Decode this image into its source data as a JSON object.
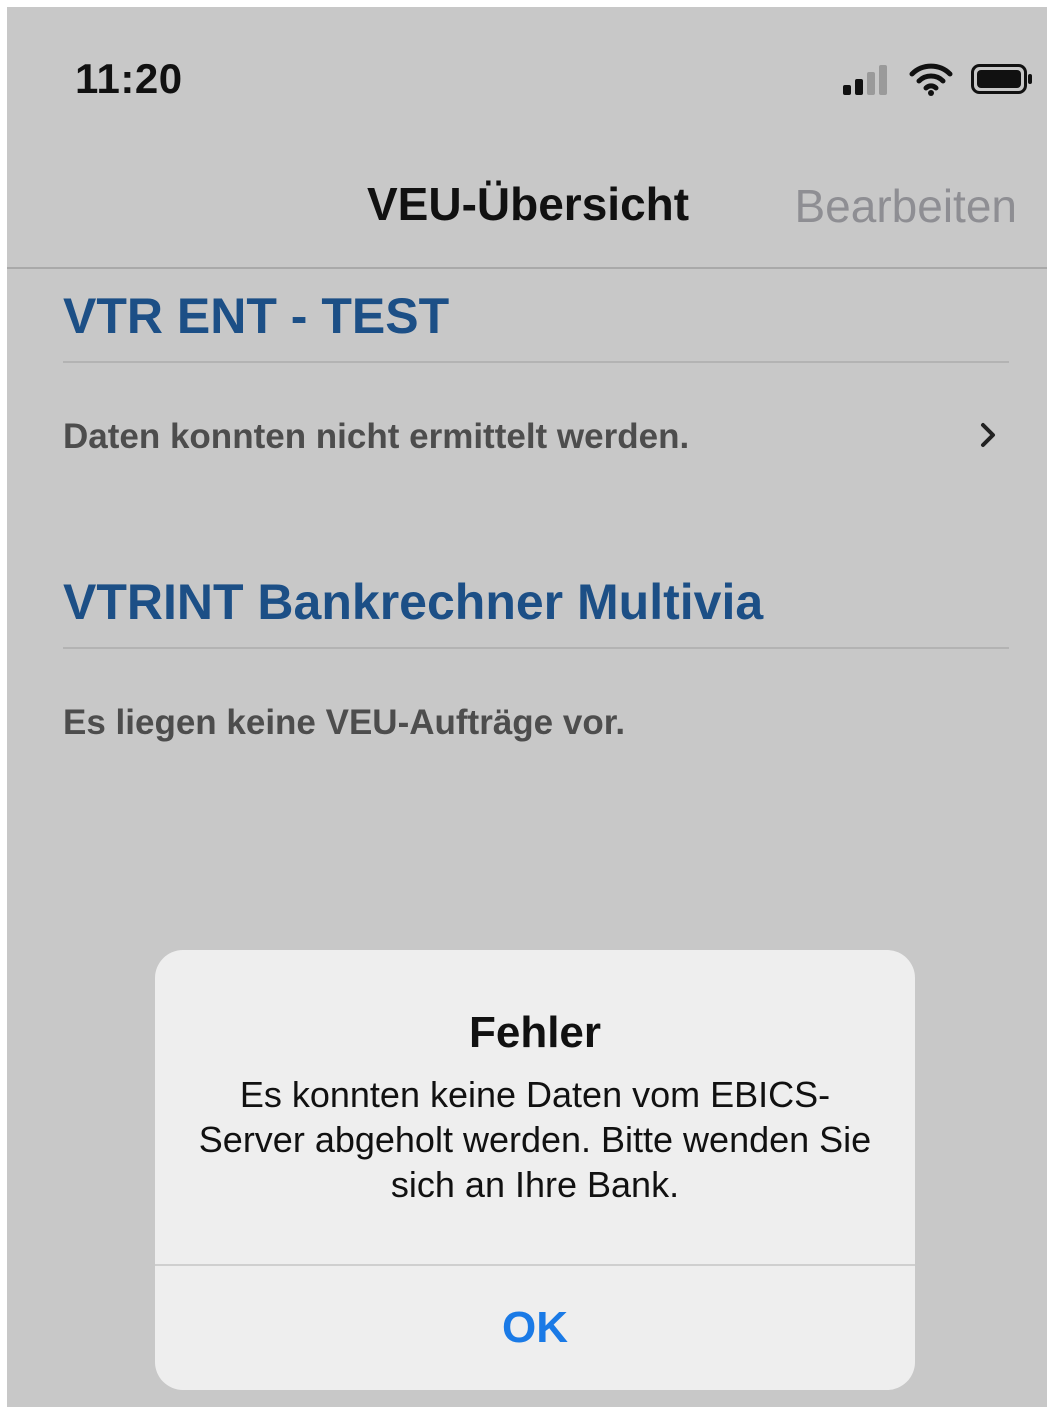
{
  "status_bar": {
    "time": "11:20",
    "icons": [
      "cellular-signal-icon",
      "wifi-icon",
      "battery-icon"
    ]
  },
  "nav_bar": {
    "title": "VEU-Übersicht",
    "edit_label": "Bearbeiten"
  },
  "sections": [
    {
      "title": "VTR ENT - TEST",
      "row_text": "Daten konnten nicht ermittelt werden.",
      "has_chevron": true
    },
    {
      "title": "VTRINT Bankrechner Multivia",
      "row_text": "Es liegen keine VEU-Aufträge vor.",
      "has_chevron": false
    }
  ],
  "alert": {
    "title": "Fehler",
    "message": "Es konnten keine Daten vom EBICS-Server abgeholt werden. Bitte wenden Sie sich an Ihre Bank.",
    "button_label": "OK"
  },
  "colors": {
    "background": "#c8c8c8",
    "section_title": "#1c4f86",
    "nav_action": "#8e8e93",
    "alert_button": "#1a7ae6"
  }
}
